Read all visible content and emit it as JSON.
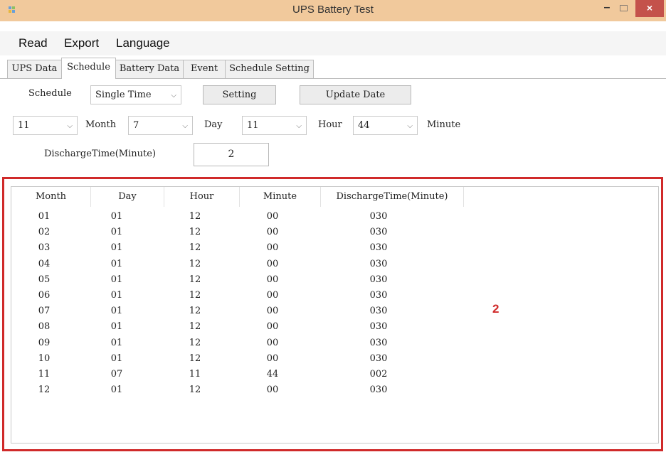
{
  "window": {
    "title": "UPS Battery Test",
    "close_glyph": "×",
    "minimize_glyph": "–"
  },
  "menu": [
    "Read",
    "Export",
    "Language"
  ],
  "tabs": [
    "UPS Data",
    "Schedule",
    "Battery Data",
    "Event",
    "Schedule Setting"
  ],
  "active_tab": "Schedule",
  "form": {
    "schedule_label": "Schedule",
    "schedule_value": "Single Time",
    "setting_button": "Setting",
    "update_date_button": "Update Date",
    "month_value": "11",
    "month_label": "Month",
    "day_value": "7",
    "day_label": "Day",
    "hour_value": "11",
    "hour_label": "Hour",
    "minute_value": "44",
    "minute_label": "Minute",
    "discharge_label": "DischargeTime(Minute)",
    "discharge_value": "2"
  },
  "table": {
    "columns": [
      "Month",
      "Day",
      "Hour",
      "Minute",
      "DischargeTime(Minute)"
    ],
    "rows": [
      [
        "01",
        "01",
        "12",
        "00",
        "030"
      ],
      [
        "02",
        "01",
        "12",
        "00",
        "030"
      ],
      [
        "03",
        "01",
        "12",
        "00",
        "030"
      ],
      [
        "04",
        "01",
        "12",
        "00",
        "030"
      ],
      [
        "05",
        "01",
        "12",
        "00",
        "030"
      ],
      [
        "06",
        "01",
        "12",
        "00",
        "030"
      ],
      [
        "07",
        "01",
        "12",
        "00",
        "030"
      ],
      [
        "08",
        "01",
        "12",
        "00",
        "030"
      ],
      [
        "09",
        "01",
        "12",
        "00",
        "030"
      ],
      [
        "10",
        "01",
        "12",
        "00",
        "030"
      ],
      [
        "11",
        "07",
        "11",
        "44",
        "002"
      ],
      [
        "12",
        "01",
        "12",
        "00",
        "030"
      ]
    ]
  },
  "annotation": "2",
  "colors": {
    "titlebar": "#f1c99c",
    "close_button": "#c4524b",
    "highlight": "#d02a2a"
  }
}
